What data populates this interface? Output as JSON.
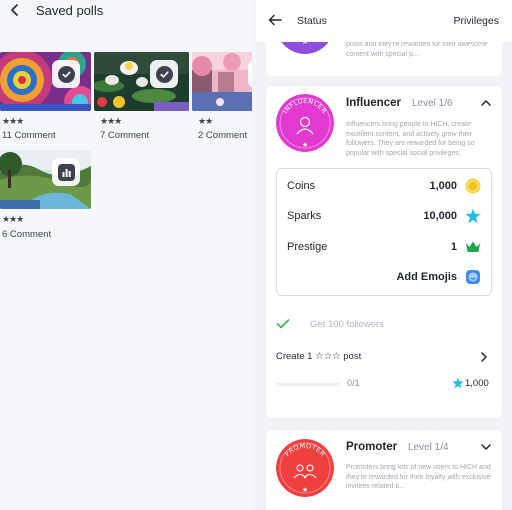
{
  "left": {
    "title": "Saved polls",
    "polls": [
      {
        "stars": "★★★",
        "comments": "11 Comment",
        "badge": "check-icon"
      },
      {
        "stars": "★★★",
        "comments": "7 Comment",
        "badge": "check-icon"
      },
      {
        "stars": "★★",
        "comments": "2 Comment",
        "badge": "check-icon"
      },
      {
        "stars": "★★★",
        "comments": "6 Comment",
        "badge": "bar-chart-icon"
      }
    ]
  },
  "right": {
    "title": "Status",
    "tab": "Privileges",
    "prev_card": {
      "desc": "posts and they're rewarded for their awesome content with special p..."
    },
    "influencer": {
      "badge_text": "INFLUENCER",
      "name": "Influencer",
      "level": "Level 1/6",
      "desc": "Influencers bring people to HICH, create excellent content, and actively grow their followers. They are rewarded for being so popular with special social privileges.",
      "rewards": [
        {
          "label": "Coins",
          "value": "1,000",
          "icon": "coin-icon"
        },
        {
          "label": "Sparks",
          "value": "10,000",
          "icon": "spark-icon"
        },
        {
          "label": "Prestige",
          "value": "1",
          "icon": "crown-icon"
        },
        {
          "label": "Add Emojis",
          "value": "",
          "icon": "emoji-icon"
        }
      ],
      "task_done": "Get 100 followers",
      "task_title": "Create 1 ☆☆☆ post",
      "progress_text": "0/1",
      "progress_fraction": 0,
      "progress_reward": "1,000"
    },
    "promoter": {
      "badge_text": "PROMOTER",
      "name": "Promoter",
      "level": "Level 1/4",
      "desc": "Promoters bring lots of new users to HICH and they're rewarded for their loyalty with exclusive invitees-related b..."
    }
  },
  "colors": {
    "influencer": "#e23ad0",
    "promoter": "#ef3f3f",
    "accent": "#3a83f7",
    "success": "#2fb34a"
  }
}
